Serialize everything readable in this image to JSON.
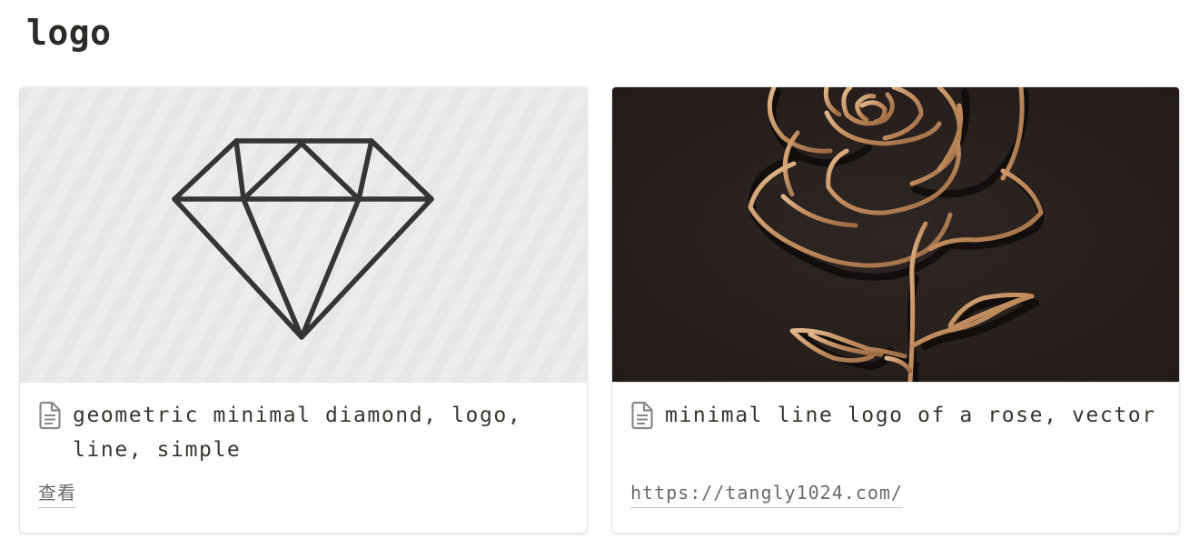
{
  "page": {
    "title": "logo"
  },
  "cards": [
    {
      "title": "geometric minimal diamond, logo, line, simple",
      "property": "查看",
      "cover_icon": "diamond-outline-logo",
      "cover_bg": "#ececeb",
      "line_color": "#353535"
    },
    {
      "title": "minimal line logo of a rose, vector",
      "property": "https://tangly1024.com/",
      "cover_icon": "rose-line-logo",
      "cover_bg": "#2a2220",
      "line_color": "#c49062"
    }
  ],
  "icons": {
    "card_page_icon": "page-icon"
  }
}
